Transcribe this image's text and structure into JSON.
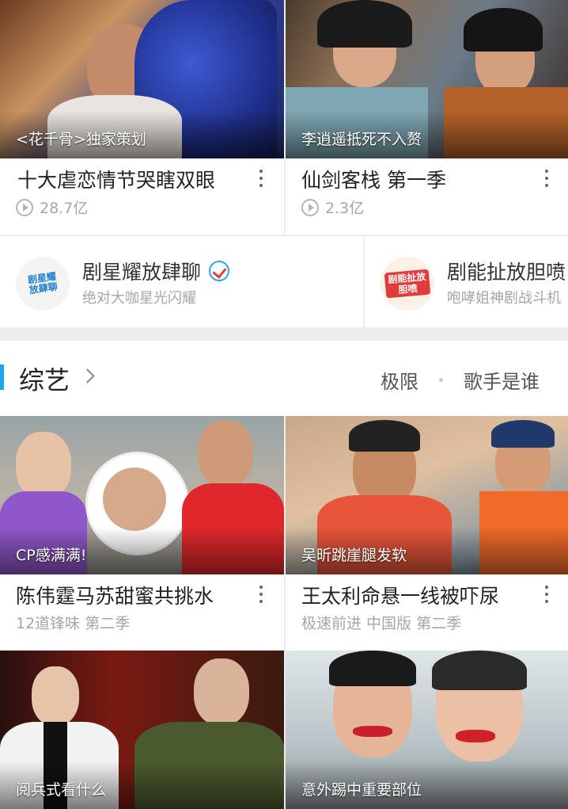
{
  "top_cards": [
    {
      "caption": "<花千骨>独家策划",
      "title": "十大虐恋情节哭瞎双眼",
      "views": "28.7亿"
    },
    {
      "caption": "李逍遥抵死不入赘",
      "title": "仙剑客栈 第一季",
      "views": "2.3亿"
    }
  ],
  "channels": [
    {
      "name": "剧星耀放肆聊",
      "desc": "绝对大咖星光闪耀",
      "logo_text": "剧星耀放肆聊",
      "verified": true
    },
    {
      "name": "剧能扯放胆喷",
      "desc": "咆哮姐神剧战斗机",
      "logo_text": "剧能扯放胆喷"
    }
  ],
  "section": {
    "title": "综艺",
    "links": [
      "极限",
      "歌手是谁"
    ]
  },
  "variety_cards": [
    {
      "caption": "CP感满满!",
      "title": "陈伟霆马苏甜蜜共挑水",
      "subtitle": "12道锋味 第二季"
    },
    {
      "caption": "吴昕跳崖腿发软",
      "title": "王太利命悬一线被吓尿",
      "subtitle": "极速前进 中国版 第二季"
    },
    {
      "caption": "阅兵式看什么",
      "title": "",
      "subtitle": ""
    },
    {
      "caption": "意外踢中重要部位",
      "title": "",
      "subtitle": ""
    }
  ],
  "colors": {
    "accent": "#1ea6f0",
    "divider": "#ececec",
    "gray_text": "#a6a6a6"
  },
  "icons": [
    "play-icon",
    "more-icon",
    "verified-icon",
    "chevron-right-icon"
  ]
}
